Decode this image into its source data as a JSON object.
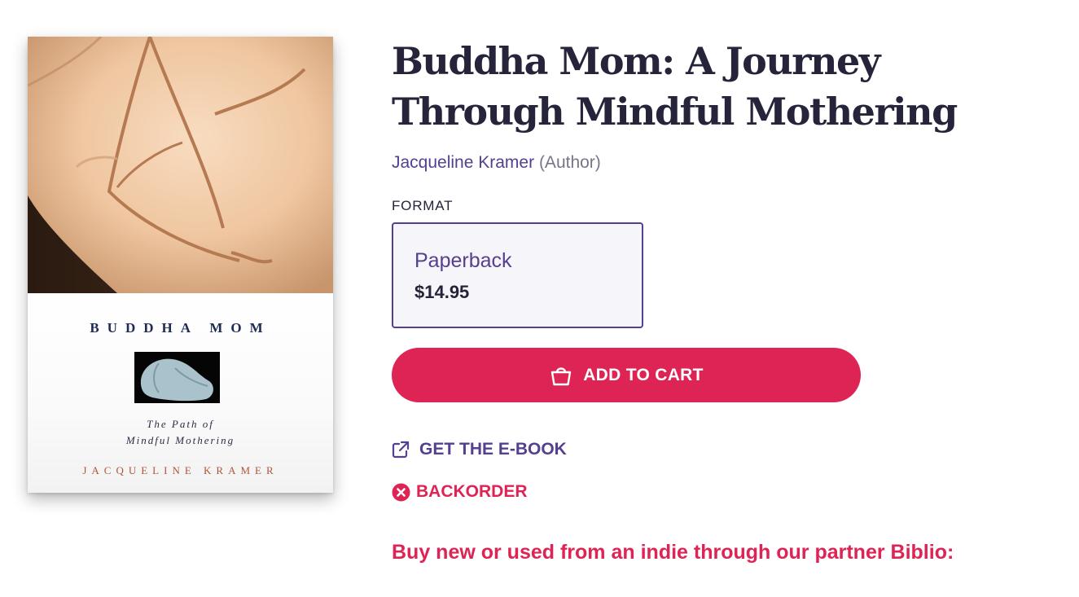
{
  "book": {
    "title": "Buddha Mom: A Journey Through Mindful Mothering",
    "author_name": "Jacqueline Kramer",
    "author_role": "(Author)"
  },
  "cover": {
    "title_text": "BUDDHA MOM",
    "subtitle_line1": "The Path of",
    "subtitle_line2": "Mindful Mothering",
    "author_text": "JACQUELINE KRAMER"
  },
  "format": {
    "label": "FORMAT",
    "options": [
      {
        "name": "Paperback",
        "price": "$14.95",
        "selected": true
      }
    ]
  },
  "actions": {
    "add_to_cart": "ADD TO CART",
    "ebook": "GET THE E-BOOK"
  },
  "status": {
    "availability": "BACKORDER"
  },
  "partner": {
    "text": "Buy new or used from an indie through our partner Biblio:"
  },
  "icons": {
    "cart": "shopping-bag-icon",
    "ebook": "external-link-icon",
    "backorder": "circle-x-icon"
  },
  "colors": {
    "accent_purple": "#55408f",
    "accent_red": "#de2454",
    "text_dark": "#25233a",
    "text_muted": "#787588",
    "card_bg": "#f6f5f9"
  }
}
